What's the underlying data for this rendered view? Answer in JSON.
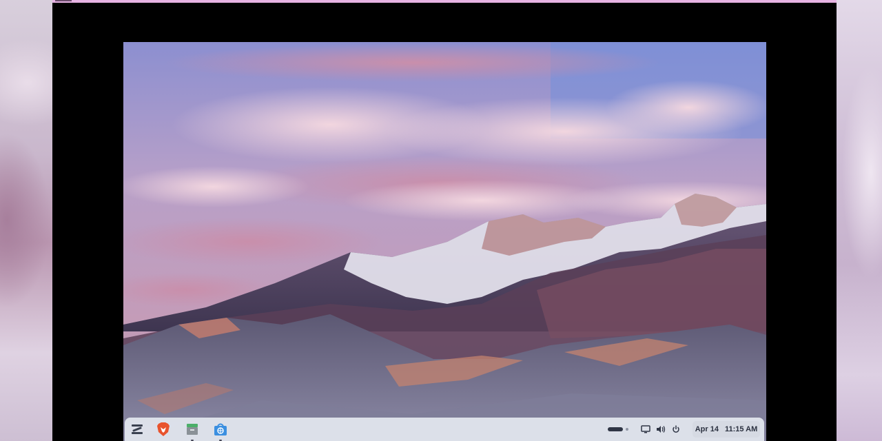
{
  "taskbar": {
    "pinned_apps": [
      {
        "name": "zorin-menu-icon"
      },
      {
        "name": "brave-browser-icon"
      },
      {
        "name": "file-archive-icon"
      },
      {
        "name": "software-store-icon"
      }
    ],
    "tray_icons": [
      "battery-icon",
      "display-icon",
      "volume-icon",
      "power-icon"
    ],
    "date": "Apr 14",
    "time": "11:15 AM"
  },
  "colors": {
    "window_titlebar": "#e6b3e3",
    "taskbar_bg": "#e4e8f0",
    "brave_orange": "#e8532d",
    "store_blue": "#3b8fe0"
  }
}
